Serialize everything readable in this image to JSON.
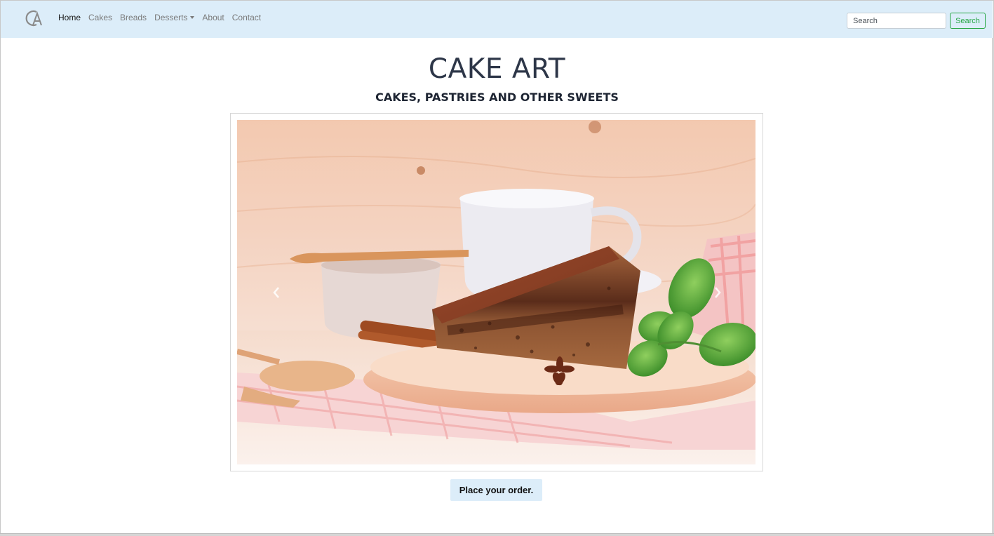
{
  "navbar": {
    "brand_icon": "cake-art-logo-icon",
    "items": [
      {
        "label": "Home",
        "active": true
      },
      {
        "label": "Cakes"
      },
      {
        "label": "Breads"
      },
      {
        "label": "Desserts",
        "dropdown": true
      },
      {
        "label": "About"
      },
      {
        "label": "Contact"
      }
    ],
    "search_placeholder": "Search",
    "search_button": "Search"
  },
  "hero": {
    "title": "CAKE ART",
    "subtitle": "CAKES, PASTRIES AND OTHER SWEETS"
  },
  "carousel": {
    "prev_icon": "chevron-left-icon",
    "next_icon": "chevron-right-icon"
  },
  "cta": {
    "label": "Place your order."
  },
  "colors": {
    "navbar_bg": "#dcedf9",
    "success": "#28a745",
    "title": "#2d3648"
  }
}
